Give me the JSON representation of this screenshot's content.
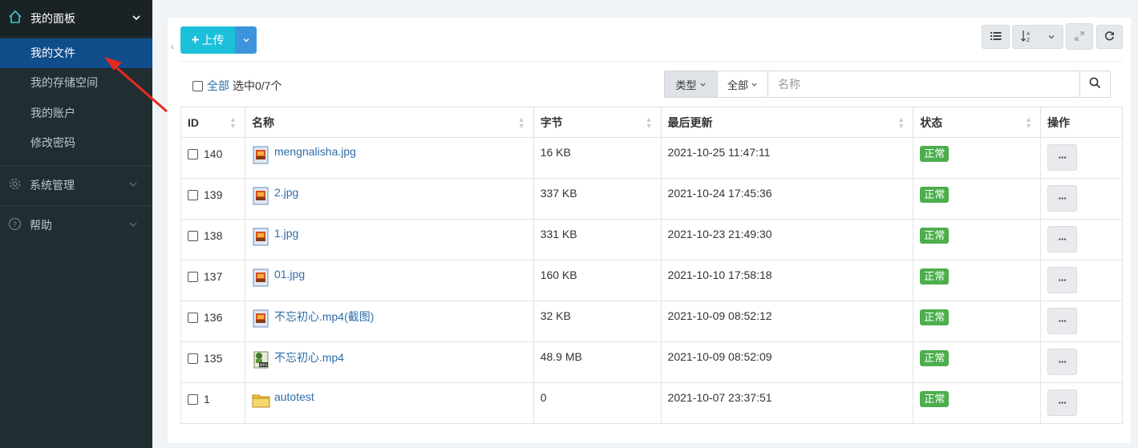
{
  "sidebar": {
    "header": "我的面板",
    "submenu": [
      "我的文件",
      "我的存储空间",
      "我的账户",
      "修改密码"
    ],
    "groups": [
      "系统管理",
      "帮助"
    ]
  },
  "toolbar": {
    "upload_label": "上传"
  },
  "filter": {
    "select_all_label": "全部",
    "selection_status": "选中0/7个",
    "type_label": "类型",
    "scope_label": "全部",
    "search_placeholder": "名称"
  },
  "table": {
    "headers": [
      "ID",
      "名称",
      "字节",
      "最后更新",
      "状态",
      "操作"
    ],
    "rows": [
      {
        "id": "140",
        "name": "mengnalisha.jpg",
        "size": "16 KB",
        "updated": "2021-10-25 11:47:11",
        "status": "正常",
        "icon": "image-file-icon",
        "op": "···"
      },
      {
        "id": "139",
        "name": "2.jpg",
        "size": "337 KB",
        "updated": "2021-10-24 17:45:36",
        "status": "正常",
        "icon": "image-file-icon",
        "op": "···"
      },
      {
        "id": "138",
        "name": "1.jpg",
        "size": "331 KB",
        "updated": "2021-10-23 21:49:30",
        "status": "正常",
        "icon": "image-file-icon",
        "op": "···"
      },
      {
        "id": "137",
        "name": "01.jpg",
        "size": "160 KB",
        "updated": "2021-10-10 17:58:18",
        "status": "正常",
        "icon": "image-file-icon",
        "op": "···"
      },
      {
        "id": "136",
        "name": "不忘初心.mp4(截图)",
        "size": "32 KB",
        "updated": "2021-10-09 08:52:12",
        "status": "正常",
        "icon": "image-file-icon",
        "op": "···"
      },
      {
        "id": "135",
        "name": "不忘初心.mp4",
        "size": "48.9 MB",
        "updated": "2021-10-09 08:52:09",
        "status": "正常",
        "icon": "mp4-file-icon",
        "op": "···"
      },
      {
        "id": "1",
        "name": "autotest",
        "size": "0",
        "updated": "2021-10-07 23:37:51",
        "status": "正常",
        "icon": "folder-icon",
        "op": "···"
      }
    ]
  },
  "colors": {
    "sidebar_bg": "#222d32",
    "active_item": "#0f4d8b",
    "upload_btn": "#1cc0d9",
    "status_ok": "#4cae4c",
    "link": "#2d6ca8",
    "annotation_arrow": "#e8291f"
  }
}
